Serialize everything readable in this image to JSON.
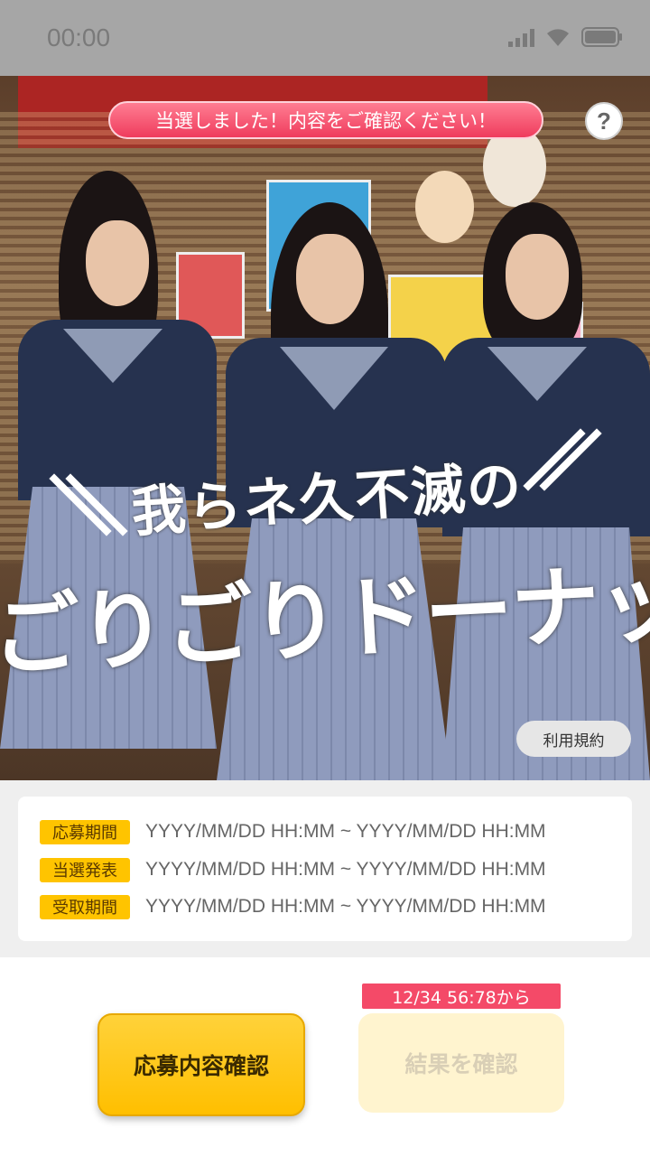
{
  "status_bar": {
    "time": "00:00"
  },
  "hero": {
    "announcement": "当選しました！内容をご確認ください！",
    "help_label": "?",
    "title_line1": "我らネ久不滅の",
    "title_line2": "ごりごりドーナッツ",
    "terms_label": "利用規約"
  },
  "schedule": [
    {
      "label": "応募期間",
      "value": "YYYY/MM/DD HH:MM ~ YYYY/MM/DD HH:MM"
    },
    {
      "label": "当選発表",
      "value": "YYYY/MM/DD HH:MM ~ YYYY/MM/DD HH:MM"
    },
    {
      "label": "受取期間",
      "value": "YYYY/MM/DD HH:MM ~ YYYY/MM/DD HH:MM"
    }
  ],
  "actions": {
    "confirm_entry": "応募内容確認",
    "countdown": "12/34 56:78から",
    "check_result": "結果を確認"
  },
  "colors": {
    "accent_yellow": "#ffc400",
    "accent_pink": "#f44a68",
    "navy": "#26324f"
  }
}
